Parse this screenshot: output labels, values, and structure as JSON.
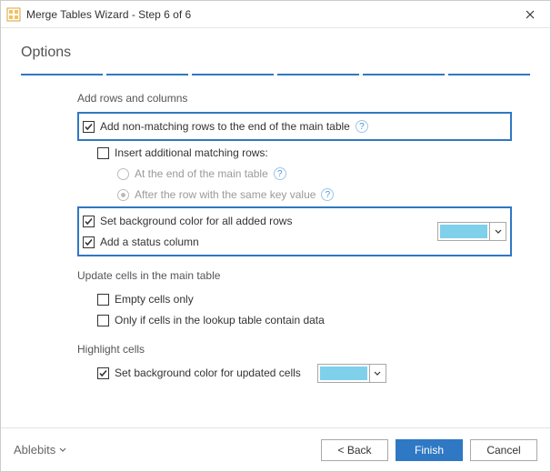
{
  "window": {
    "title": "Merge Tables Wizard - Step 6 of 6"
  },
  "page": {
    "heading": "Options"
  },
  "sections": {
    "add": {
      "label": "Add rows and columns",
      "non_matching": "Add non-matching rows to the end of the main table",
      "insert_matching": "Insert additional matching rows:",
      "opt_end": "At the end of the main table",
      "opt_after": "After the row with the same key value",
      "bg_added": "Set background color for all added rows",
      "status_col": "Add a status column"
    },
    "update": {
      "label": "Update cells in the main table",
      "empty_only": "Empty cells only",
      "only_if": "Only if cells in the lookup table contain data"
    },
    "highlight": {
      "label": "Highlight cells",
      "bg_updated": "Set background color for updated cells"
    }
  },
  "colors": {
    "added_swatch": "#7fd0eb",
    "updated_swatch": "#7fd0eb"
  },
  "footer": {
    "brand": "Ablebits",
    "back": "<  Back",
    "finish": "Finish",
    "cancel": "Cancel"
  }
}
